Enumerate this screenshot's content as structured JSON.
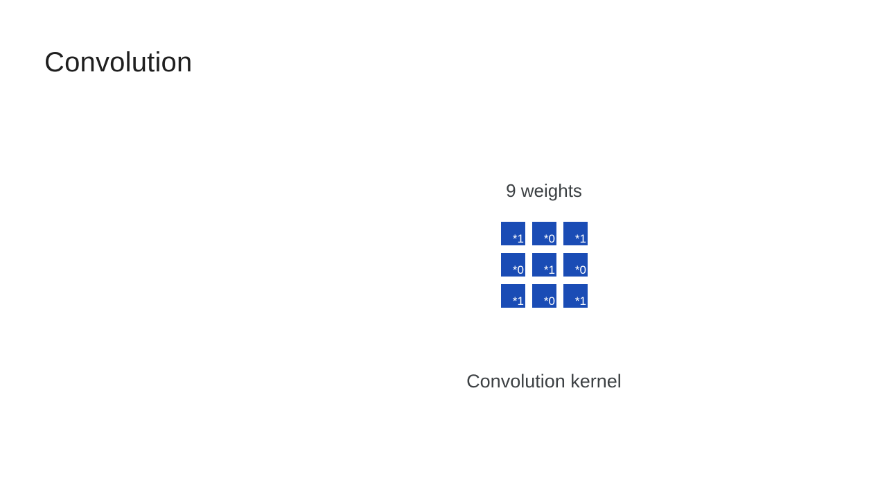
{
  "slide": {
    "title": "Convolution"
  },
  "diagram": {
    "weights_label": "9 weights",
    "kernel_label": "Convolution kernel",
    "kernel_color": "#1a4cb5",
    "kernel_cells": [
      "*1",
      "*0",
      "*1",
      "*0",
      "*1",
      "*0",
      "*1",
      "*0",
      "*1"
    ]
  }
}
